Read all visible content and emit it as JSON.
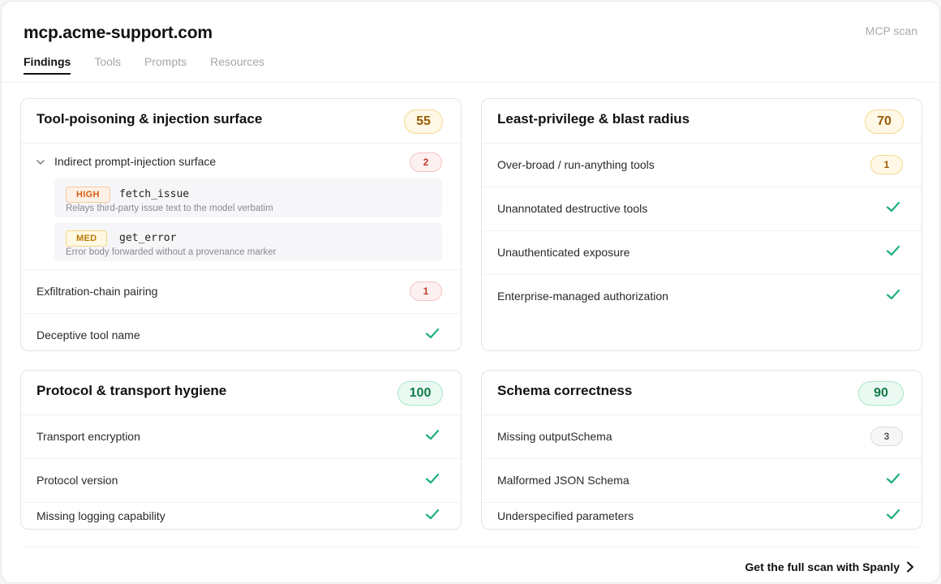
{
  "header": {
    "title": "mcp.acme-support.com",
    "scan_label": "MCP scan",
    "tabs": [
      {
        "label": "Findings",
        "active": true
      },
      {
        "label": "Tools",
        "active": false
      },
      {
        "label": "Prompts",
        "active": false
      },
      {
        "label": "Resources",
        "active": false
      }
    ]
  },
  "cards": {
    "injection": {
      "title": "Tool-poisoning & injection surface",
      "score": "55",
      "group": {
        "label": "Indirect prompt-injection surface",
        "count": "2",
        "items": [
          {
            "severity": "HIGH",
            "tool": "fetch_issue",
            "description": "Relays third-party issue text to the model verbatim"
          },
          {
            "severity": "MED",
            "tool": "get_error",
            "description": "Error body forwarded without a provenance marker"
          }
        ]
      },
      "rows": [
        {
          "label": "Exfiltration-chain pairing",
          "count": "1"
        },
        {
          "label": "Deceptive tool name",
          "status": "pass"
        }
      ]
    },
    "privilege": {
      "title": "Least-privilege & blast radius",
      "score": "70",
      "rows": [
        {
          "label": "Over-broad / run-anything tools",
          "count": "1"
        },
        {
          "label": "Unannotated destructive tools",
          "status": "pass"
        },
        {
          "label": "Unauthenticated exposure",
          "status": "pass"
        },
        {
          "label": "Enterprise-managed authorization",
          "status": "pass"
        }
      ]
    },
    "protocol": {
      "title": "Protocol & transport hygiene",
      "score": "100",
      "rows": [
        {
          "label": "Transport encryption",
          "status": "pass"
        },
        {
          "label": "Protocol version",
          "status": "pass"
        },
        {
          "label": "Missing logging capability",
          "status": "pass"
        }
      ]
    },
    "schema": {
      "title": "Schema correctness",
      "score": "90",
      "rows": [
        {
          "label": "Missing outputSchema",
          "count": "3"
        },
        {
          "label": "Malformed JSON Schema",
          "status": "pass"
        },
        {
          "label": "Underspecified parameters",
          "status": "pass"
        }
      ]
    }
  },
  "footer": {
    "cta_label": "Get the full scan with Spanly"
  },
  "colors": {
    "pass_green": "#1fb07a",
    "amber": "#9a5b07",
    "red": "#c0392b",
    "green_score": "#127a4a"
  },
  "icons": {
    "pass": "check-icon",
    "expand": "chevron-down-icon",
    "cta": "chevron-right-icon"
  }
}
